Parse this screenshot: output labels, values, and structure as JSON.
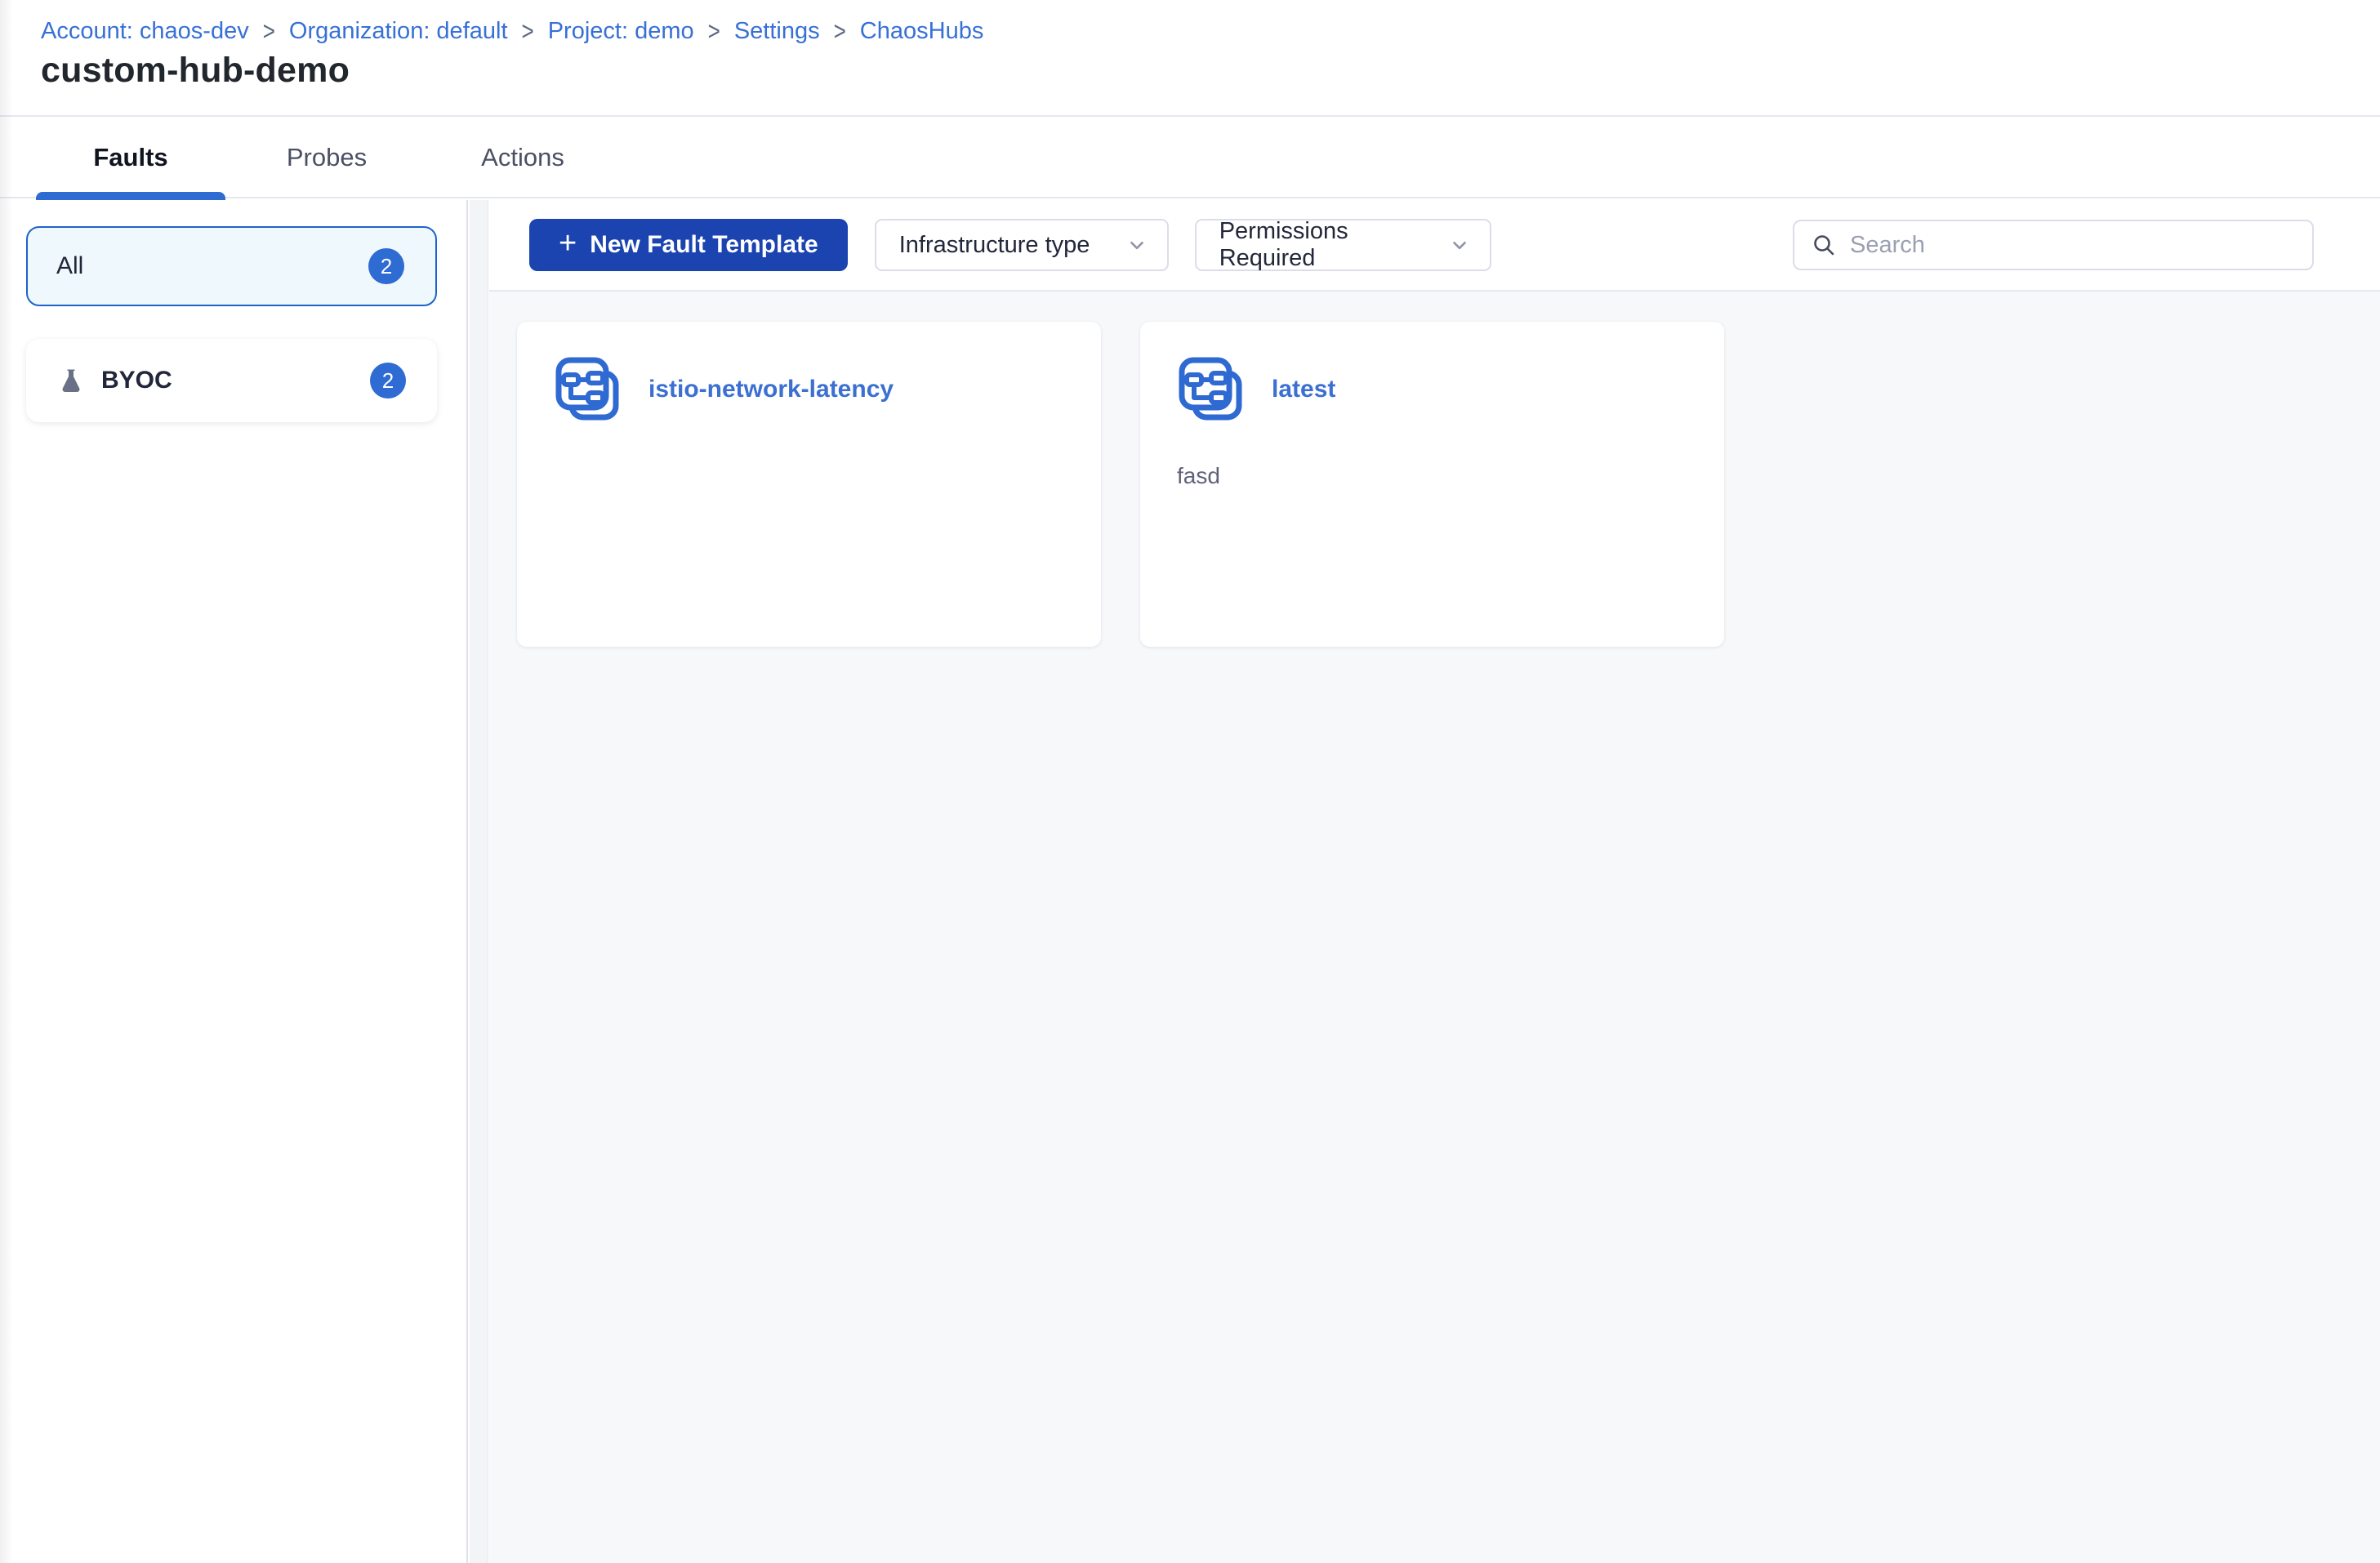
{
  "breadcrumb": {
    "separator": ">",
    "items": [
      {
        "label": "Account: chaos-dev"
      },
      {
        "label": "Organization: default"
      },
      {
        "label": "Project: demo"
      },
      {
        "label": "Settings"
      },
      {
        "label": "ChaosHubs"
      }
    ]
  },
  "page": {
    "title": "custom-hub-demo"
  },
  "tabs": [
    {
      "label": "Faults",
      "active": true
    },
    {
      "label": "Probes",
      "active": false
    },
    {
      "label": "Actions",
      "active": false
    }
  ],
  "sidebar": {
    "filters": [
      {
        "label": "All",
        "count": "2",
        "selected": true
      },
      {
        "label": "BYOC",
        "count": "2",
        "icon": "flask-icon",
        "selected": false
      }
    ]
  },
  "toolbar": {
    "new_template_button": {
      "plus": "+",
      "label": "New Fault Template"
    },
    "filters": [
      {
        "label": "Infrastructure type"
      },
      {
        "label": "Permissions Required"
      }
    ],
    "search": {
      "placeholder": "Search",
      "value": "",
      "icon": "search-icon"
    }
  },
  "cards": [
    {
      "title": "istio-network-latency",
      "description": "",
      "icon": "fault-template-icon"
    },
    {
      "title": "latest",
      "description": "fasd",
      "icon": "fault-template-icon"
    }
  ],
  "colors": {
    "link_blue": "#3770D6",
    "primary_button_blue": "#1B44B0",
    "badge_blue": "#2E6BD3",
    "active_tab_underline": "#2E6BD3",
    "selected_filter_bg": "#EFF8FC",
    "selected_filter_border": "#1D63C9",
    "card_title_blue": "#3B6FD1",
    "icon_blue": "#2F6AD2",
    "content_bg": "#F7F8FA",
    "divider": "#E6E7EE",
    "title_text": "#22272E",
    "muted_text": "#60627A"
  }
}
